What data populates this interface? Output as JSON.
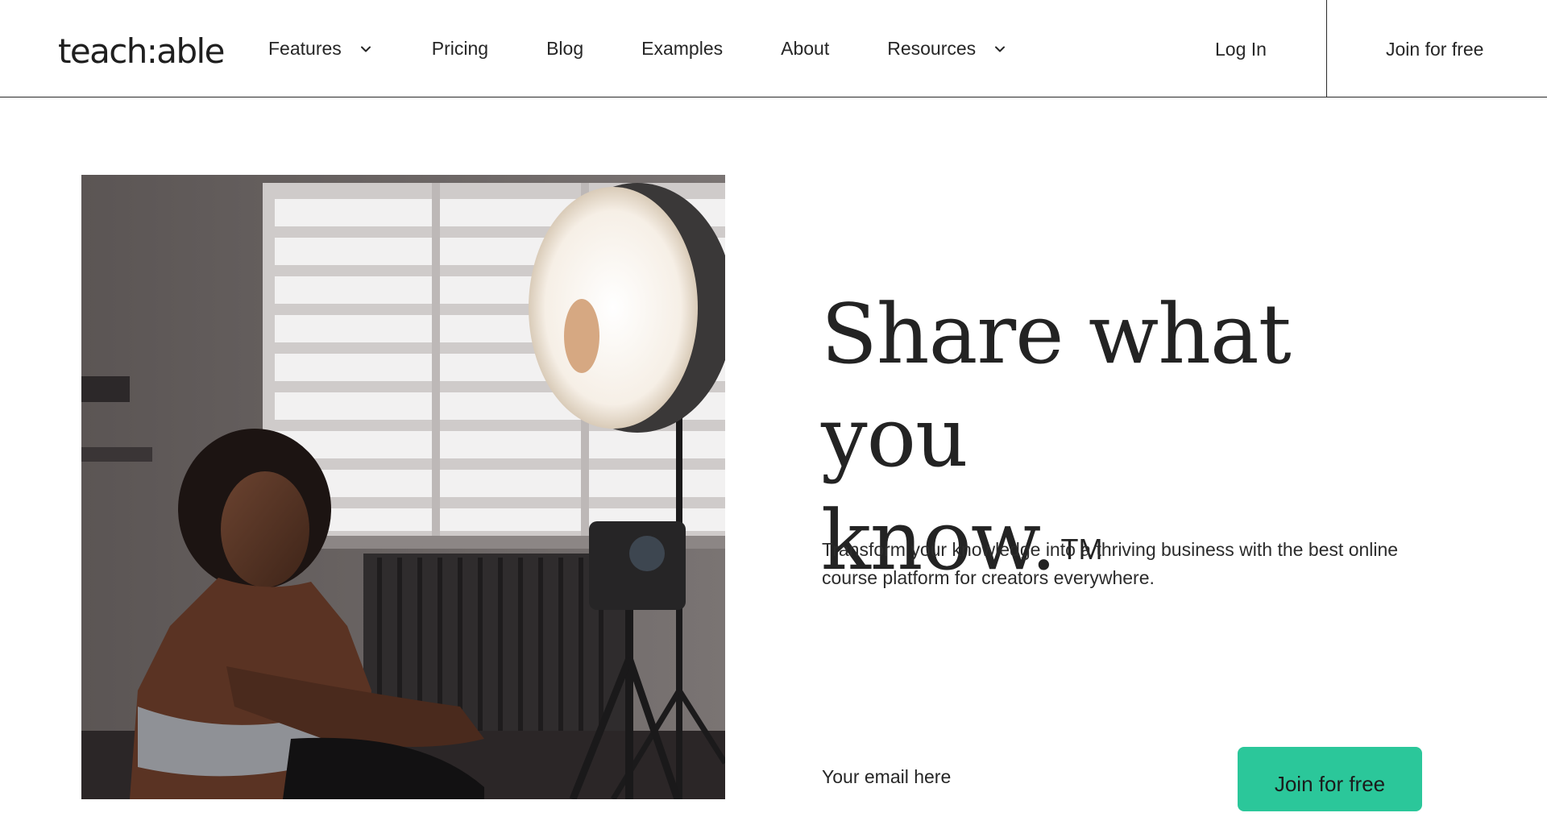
{
  "header": {
    "logo_text": "teach:able",
    "nav": [
      {
        "label": "Features",
        "dropdown": true
      },
      {
        "label": "Pricing",
        "dropdown": false
      },
      {
        "label": "Blog",
        "dropdown": false
      },
      {
        "label": "Examples",
        "dropdown": false
      },
      {
        "label": "About",
        "dropdown": false
      },
      {
        "label": "Resources",
        "dropdown": true
      }
    ],
    "login_label": "Log In",
    "join_label": "Join for free"
  },
  "hero": {
    "title_line1": "Share what you",
    "title_line2": "know.",
    "trademark": "TM",
    "subtitle": "Transform your knowledge into a thriving business with the best online course platform for creators everywhere.",
    "email_placeholder": "Your email here",
    "cta_label": "Join for free"
  },
  "colors": {
    "accent": "#2bc79a",
    "text": "#1f1f1f",
    "border": "#2a2a2a"
  },
  "icons": {
    "dropdown": "chevron-down-icon"
  }
}
